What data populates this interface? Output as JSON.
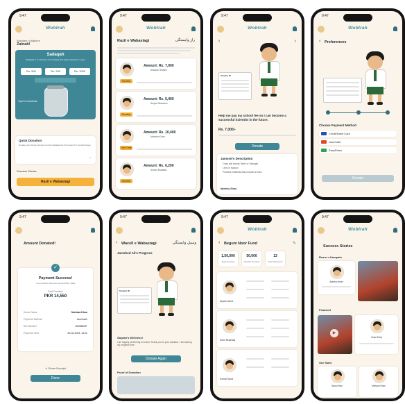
{
  "status_time": "9:47",
  "logo": "Wobtrah",
  "phone1": {
    "greeting": "Assalam o Alaikum",
    "user": "Zainab!",
    "card_title": "Sadaqah",
    "card_text": "Sadaqah is a voluntary act of charity that helps students in need.",
    "amounts": [
      "Rs. 500",
      "Rs. 200",
      "Rs. 1000"
    ],
    "tap_text": "Tap! to Contribute",
    "quick_title": "Quick Donation",
    "quick_text": "Donate your chosen amount and let Sadaqah be the reason for needed hopes",
    "success_label": "Success Stories",
    "cta": "Razil e Wabastagi"
  },
  "phone2": {
    "title": "Razil e Wabastagi",
    "urdu": "رازِ وابستگی",
    "items": [
      {
        "amount": "Amount: Rs. 7,000",
        "name": "Arsalan Shaikh",
        "tag": "Monthly"
      },
      {
        "amount": "Amount: Rs. 5,400",
        "name": "Amjad Waseem",
        "tag": "Monthly"
      },
      {
        "amount": "Amount: Rs. 10,400",
        "name": "Mariam Khan",
        "tag": "One Time"
      },
      {
        "amount": "Amount: Rs. 6,200",
        "name": "Anwar Mustafa",
        "tag": "Monthly"
      }
    ]
  },
  "phone3": {
    "student_label": "Student ID",
    "plea": "Help me pay my school fee so I can become a successful Scientist in the future.",
    "amount": "Rs. 7,000/-",
    "donate": "Donate",
    "desc_title": "Jamsed's Description",
    "desc_items": [
      "Class add except Tahmi or Sadaqah",
      "Lives in Karachi",
      "Provides materials that promote an idea"
    ],
    "more": "Mystery Story"
  },
  "phone4": {
    "title": "Preferences",
    "method_title": "Choose Payment Method",
    "methods": [
      "Credit/Debit Card",
      "JazzCash",
      "EasyPaisa"
    ],
    "donate": "Donate"
  },
  "phone5": {
    "title": "Amount Donated!",
    "success": "Payment Success!",
    "subtitle": "Your donation has been successfully made",
    "total_label": "Total Donation",
    "total": "PKR 14,550",
    "rows": [
      {
        "label": "Donor Name",
        "value": "Murtaza Khan"
      },
      {
        "label": "Payment Method",
        "value": "JazzCash"
      },
      {
        "label": "Ref Number",
        "value": "000085257"
      },
      {
        "label": "Payment Time",
        "value": "25-02-2023, 13:22"
      }
    ],
    "share": "Share Receipt",
    "done": "Done"
  },
  "phone6": {
    "title": "Wacell e Wabastagi",
    "urdu": "وسیلِ وابستگی",
    "progress_title": "Jamshed Ali's Progress",
    "quote_title": "Sayaan's Wellness!",
    "quote_text": "I am happily performing in school. Thank you for your donation. I am sharing my progress here.",
    "donate_again": "Donate Again",
    "proof": "Proof of Donation"
  },
  "phone7": {
    "title": "Begum Noor Fund",
    "stats": [
      {
        "value": "1,50,000",
        "label": "Total Donation"
      },
      {
        "value": "50,000",
        "label": "Monthly Donation"
      },
      {
        "value": "13",
        "label": "Total Recipients"
      }
    ],
    "people": [
      "Anjali Lamdi",
      "Sohil Mushtaq",
      "Komal Saud"
    ]
  },
  "phone8": {
    "title": "Success Stories",
    "sec1": "Rearn n Kampain",
    "sec2": "Featured",
    "sec3": "Our Stars",
    "names": [
      "Ayesha Imran",
      "Huda Tariq",
      "Sana Khan",
      "Murtaza Khan"
    ]
  }
}
